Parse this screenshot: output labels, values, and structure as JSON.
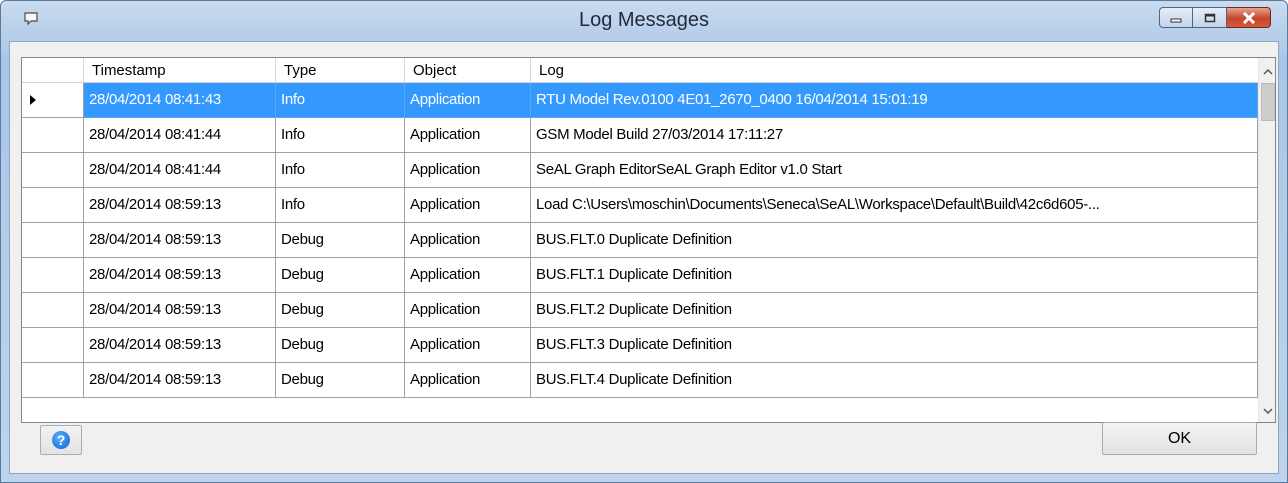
{
  "window": {
    "title": "Log Messages",
    "icon": "speech-bubble-icon"
  },
  "columns": [
    "Timestamp",
    "Type",
    "Object",
    "Log"
  ],
  "rows": [
    {
      "timestamp": "28/04/2014 08:41:43",
      "type": "Info",
      "object": "Application",
      "log": "RTU Model Rev.0100 4E01_2670_0400 16/04/2014 15:01:19",
      "selected": true
    },
    {
      "timestamp": "28/04/2014 08:41:44",
      "type": "Info",
      "object": "Application",
      "log": "GSM Model Build 27/03/2014 17:11:27"
    },
    {
      "timestamp": "28/04/2014 08:41:44",
      "type": "Info",
      "object": "Application",
      "log": "SeAL Graph EditorSeAL Graph Editor v1.0 Start"
    },
    {
      "timestamp": "28/04/2014 08:59:13",
      "type": "Info",
      "object": "Application",
      "log": "Load C:\\Users\\moschin\\Documents\\Seneca\\SeAL\\Workspace\\Default\\Build\\42c6d605-..."
    },
    {
      "timestamp": "28/04/2014 08:59:13",
      "type": "Debug",
      "object": "Application",
      "log": "BUS.FLT.0 Duplicate Definition"
    },
    {
      "timestamp": "28/04/2014 08:59:13",
      "type": "Debug",
      "object": "Application",
      "log": "BUS.FLT.1 Duplicate Definition"
    },
    {
      "timestamp": "28/04/2014 08:59:13",
      "type": "Debug",
      "object": "Application",
      "log": "BUS.FLT.2 Duplicate Definition"
    },
    {
      "timestamp": "28/04/2014 08:59:13",
      "type": "Debug",
      "object": "Application",
      "log": "BUS.FLT.3 Duplicate Definition"
    },
    {
      "timestamp": "28/04/2014 08:59:13",
      "type": "Debug",
      "object": "Application",
      "log": "BUS.FLT.4 Duplicate Definition"
    }
  ],
  "buttons": {
    "help_icon": "question-mark-icon",
    "help_glyph": "?",
    "ok_label": "OK"
  },
  "colors": {
    "selection": "#3399ff",
    "close_button": "#c7442b"
  }
}
